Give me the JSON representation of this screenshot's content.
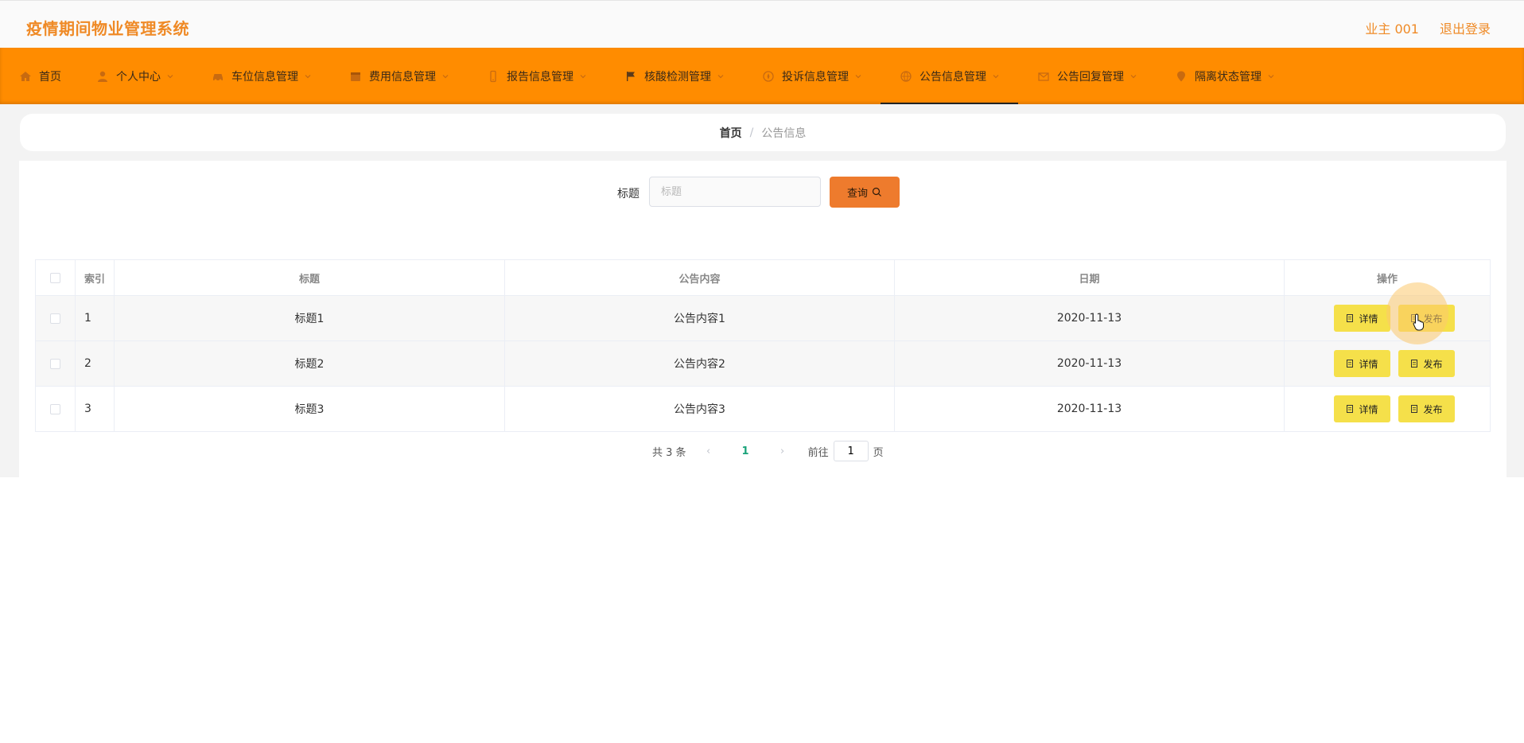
{
  "header": {
    "app_title": "疫情期间物业管理系统",
    "user_label": "业主 001",
    "logout_label": "退出登录"
  },
  "nav": {
    "items": [
      {
        "label": "首页",
        "icon": "home-icon"
      },
      {
        "label": "个人中心",
        "icon": "user-icon"
      },
      {
        "label": "车位信息管理",
        "icon": "car-icon"
      },
      {
        "label": "费用信息管理",
        "icon": "calendar-icon"
      },
      {
        "label": "报告信息管理",
        "icon": "phone-icon"
      },
      {
        "label": "核酸检测管理",
        "icon": "flag-icon"
      },
      {
        "label": "投诉信息管理",
        "icon": "compass-icon"
      },
      {
        "label": "公告信息管理",
        "icon": "globe-icon",
        "active": true
      },
      {
        "label": "公告回复管理",
        "icon": "mail-icon"
      },
      {
        "label": "隔离状态管理",
        "icon": "location-icon"
      }
    ]
  },
  "breadcrumb": {
    "home": "首页",
    "separator": "/",
    "current": "公告信息"
  },
  "search": {
    "label": "标题",
    "placeholder": "标题",
    "button_label": "查询"
  },
  "table": {
    "columns": [
      "索引",
      "标题",
      "公告内容",
      "日期",
      "操作"
    ],
    "rows": [
      {
        "index": "1",
        "title": "标题1",
        "content": "公告内容1",
        "date": "2020-11-13"
      },
      {
        "index": "2",
        "title": "标题2",
        "content": "公告内容2",
        "date": "2020-11-13"
      },
      {
        "index": "3",
        "title": "标题3",
        "content": "公告内容3",
        "date": "2020-11-13"
      }
    ],
    "detail_label": "详情",
    "publish_label": "发布"
  },
  "pagination": {
    "total_text": "共 3 条",
    "current_page": "1",
    "goto_label": "前往",
    "page_input": "1",
    "page_suffix": "页"
  },
  "colors": {
    "brand": "#ff8c00",
    "title_text": "#ef8a26",
    "search_button": "#ee7b2d",
    "action_button": "#f5e04a",
    "active_page": "#1aa37a"
  }
}
